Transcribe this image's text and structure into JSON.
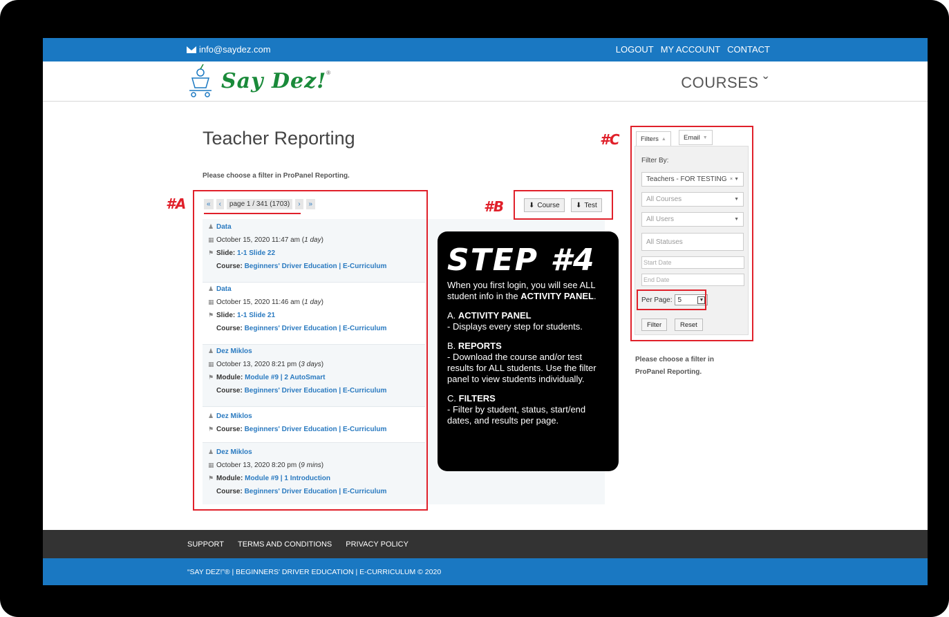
{
  "topbar": {
    "email": "info@saydez.com",
    "links": [
      "LOGOUT",
      "MY ACCOUNT",
      "CONTACT"
    ]
  },
  "header": {
    "brand": "Say Dez!",
    "reg": "®",
    "menu": "COURSES ˇ"
  },
  "page": {
    "title": "Teacher Reporting",
    "subtitle": "Please choose a filter in ProPanel Reporting."
  },
  "markers": {
    "a": "#A",
    "b": "#B",
    "c": "#C"
  },
  "pager": {
    "first": "«",
    "prev": "‹",
    "text": "page 1 / 341 (1703)",
    "next": "›",
    "last": "»"
  },
  "activity": [
    {
      "user": "Data",
      "date": "October 15, 2020 11:47 am",
      "ago": "1 day",
      "kind": "Slide:",
      "item": "1-1 Slide 22",
      "course_label": "Course:",
      "course": "Beginners' Driver Education | E-Curriculum"
    },
    {
      "user": "Data",
      "date": "October 15, 2020 11:46 am",
      "ago": "1 day",
      "kind": "Slide:",
      "item": "1-1 Slide 21",
      "course_label": "Course:",
      "course": "Beginners' Driver Education | E-Curriculum"
    },
    {
      "user": "Dez Miklos",
      "date": "October 13, 2020 8:21 pm",
      "ago": "3 days",
      "kind": "Module:",
      "item": "Module #9 | 2 AutoSmart",
      "course_label": "Course:",
      "course": "Beginners' Driver Education | E-Curriculum"
    },
    {
      "user": "Dez Miklos",
      "course_label": "Course:",
      "course": "Beginners' Driver Education | E-Curriculum"
    },
    {
      "user": "Dez Miklos",
      "date": "October 13, 2020 8:20 pm",
      "ago": "9 mins",
      "kind": "Module:",
      "item": "Module #9 | 1 Introduction",
      "course_label": "Course:",
      "course": "Beginners' Driver Education | E-Curriculum"
    }
  ],
  "reports": {
    "course": "Course",
    "test": "Test"
  },
  "step": {
    "heading": "STEP #4",
    "intro_a": "When you first login, you will see ALL student info in the ",
    "intro_b": "ACTIVITY PANEL",
    "intro_c": ".",
    "a_prefix": "A. ",
    "a_title": "ACTIVITY PANEL",
    "a_text": " - Displays every step for students.",
    "b_prefix": "B. ",
    "b_title": "REPORTS",
    "b_text": " - Download the course and/or test results for ALL students. Use the filter panel to view students individually.",
    "c_prefix": "C. ",
    "c_title": "FILTERS",
    "c_text": " - Filter by student, status, start/end dates, and results per page."
  },
  "filters": {
    "tab_filters": "Filters",
    "tab_email": "Email",
    "filter_by": "Filter By:",
    "group": "Teachers - FOR TESTING",
    "courses": "All Courses",
    "users": "All Users",
    "statuses": "All Statuses",
    "start_date": "Start Date",
    "end_date": "End Date",
    "per_page_label": "Per Page:",
    "per_page_value": "5",
    "filter_btn": "Filter",
    "reset_btn": "Reset",
    "note": "Please choose a filter in ProPanel Reporting."
  },
  "footer": {
    "links": [
      "SUPPORT",
      "TERMS AND CONDITIONS",
      "PRIVACY POLICY"
    ],
    "copyright": "“SAY DEZ!”® | BEGINNERS' DRIVER EDUCATION | E-CURRICULUM © 2020"
  },
  "colors": {
    "brand_blue": "#1a78c2",
    "annotation_red": "#e0202a",
    "brand_green": "#1a8a3a",
    "link": "#2a7ac0"
  }
}
